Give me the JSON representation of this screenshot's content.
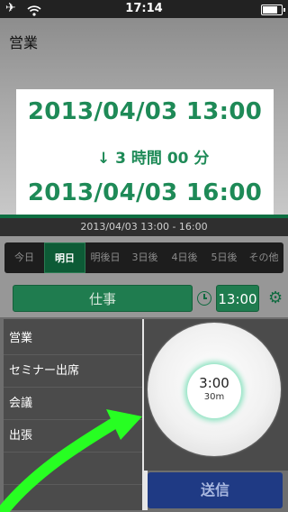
{
  "status_bar": {
    "time": "17:14",
    "battery_level": 0.9
  },
  "header": {
    "title": "営業"
  },
  "time_range": {
    "start": "2013/04/03 13:00",
    "duration": "↓ 3 時間 00 分",
    "end": "2013/04/03 16:00",
    "summary": "2013/04/03 13:00 - 16:00"
  },
  "day_tabs": [
    "今日",
    "明日",
    "明後日",
    "3日後",
    "4日後",
    "5日後",
    "その他"
  ],
  "selected_day": "明日",
  "category_button": "仕事",
  "time_button": "13:00",
  "categories": [
    "営業",
    "セミナー出席",
    "会議",
    "出張"
  ],
  "dial": {
    "time": "3:00",
    "sub": "30m"
  },
  "send_button": "送信"
}
